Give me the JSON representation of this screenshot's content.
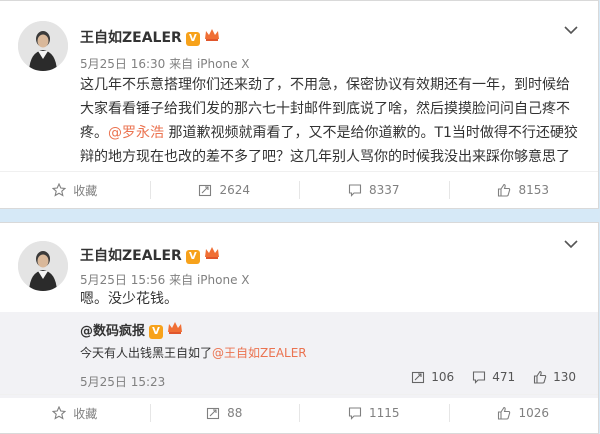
{
  "posts": [
    {
      "author": "王自如ZEALER",
      "time": "5月25日 16:30",
      "source": "来自 iPhone X",
      "text_before": "这几年不乐意搭理你们还来劲了，不用急，保密协议有效期还有一年，到时候给大家看看锤子给我们发的那六七十封邮件到底说了啥，然后摸摸脸问问自己疼不疼。",
      "mention": "@罗永浩",
      "text_after": " 那道歉视频就甭看了，又不是给你道歉的。T1当时做得不行还硬狡辩的地方现在也改的差不多了吧？这几年别人骂你的时候我没出来踩你够意思了",
      "actions": {
        "favorite": "收藏",
        "repost": "2624",
        "comment": "8337",
        "like": "8153"
      }
    },
    {
      "author": "王自如ZEALER",
      "time": "5月25日 15:56",
      "source": "来自 iPhone X",
      "text": "嗯。没少花钱。",
      "repost": {
        "author": "@数码疯报",
        "text": "今天有人出钱黑王自如了",
        "mention": "@王自如ZEALER",
        "time": "5月25日 15:23",
        "reposts": "106",
        "comments": "471",
        "likes": "130"
      },
      "actions": {
        "favorite": "收藏",
        "repost": "88",
        "comment": "1115",
        "like": "1026"
      }
    }
  ],
  "badge_v": "V",
  "colors": {
    "mention": "#eb7350",
    "verified": "#f7a21b",
    "background": "#d6e9f7"
  }
}
